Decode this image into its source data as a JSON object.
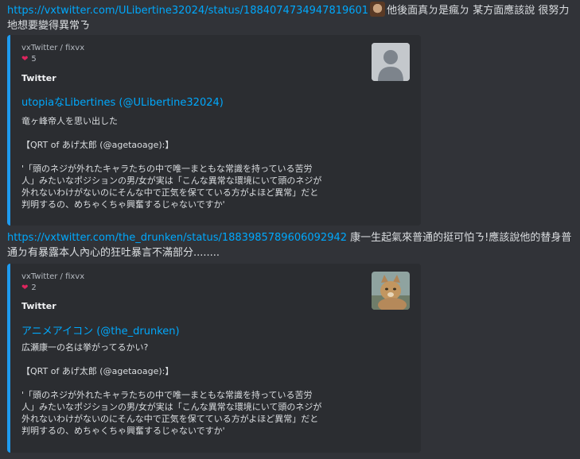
{
  "messages": [
    {
      "link": "https://vxtwitter.com/ULibertine32024/status/1884074734947819601",
      "text": "他後面真ㄉ是瘋ㄉ 某方面應該說 很努力地想要變得異常ㄋ",
      "emoji": "face-emoji",
      "embed": {
        "author": "vxTwitter / fixvx",
        "likes": "5",
        "site": "Twitter",
        "title": "utopiaなLibertines (@ULibertine32024)",
        "description": "竜ヶ峰帝人を思い出した\n\n【QRT of あげ太郎 (@agetaoage):】\n\n'「頭のネジが外れたキャラたちの中で唯一まともな常識を持っている苦労\n人」みたいなポジションの男/女が実は「こんな異常な環境にいて頭のネジが\n外れないわけがないのにそんな中で正気を保てている方がよほど異常」だと\n判明するの、めちゃくちゃ興奮するじゃないですか'",
        "thumbnail": "default-avatar-icon"
      }
    },
    {
      "link": "https://vxtwitter.com/the_drunken/status/1883985789606092942",
      "text": " 康一生起氣來普通的挺可怕ㄋ!應該說他的替身普通ㄉ有暴露本人內心的狂吐暴言不滿部分........",
      "embed": {
        "author": "vxTwitter / fixvx",
        "likes": "2",
        "site": "Twitter",
        "title": "アニメアイコン (@the_drunken)",
        "description": "広瀬康一の名は挙がってるかい?\n\n【QRT of あげ太郎 (@agetaoage):】\n\n'「頭のネジが外れたキャラたちの中で唯一まともな常識を持っている苦労\n人」みたいなポジションの男/女が実は「こんな異常な環境にいて頭のネジが\n外れないわけがないのにそんな中で正気を保てている方がよほど異常」だと\n判明するの、めちゃくちゃ興奮するじゃないですか'",
        "thumbnail": "cat-photo"
      }
    }
  ],
  "colors": {
    "link": "#00a8fc",
    "embed_border": "#1e9bf0",
    "heart": "#e0245e"
  }
}
